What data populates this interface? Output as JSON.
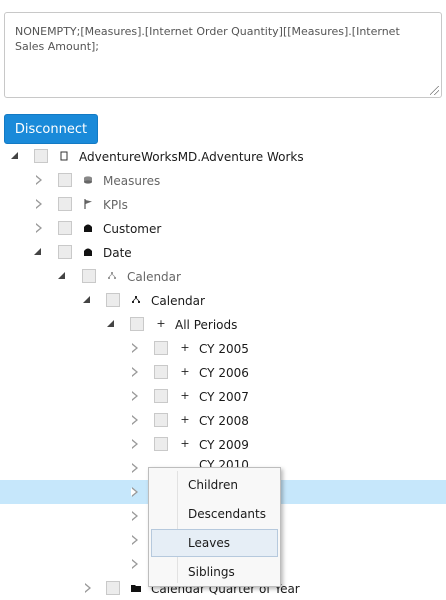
{
  "query": {
    "text": "NONEMPTY;[Measures].[Internet Order Quantity][[Measures].[Internet Sales Amount];"
  },
  "toolbar": {
    "disconnect_label": "Disconnect"
  },
  "tree": {
    "root_label": "AdventureWorksMD.Adventure Works",
    "measures_label": "Measures",
    "kpis_label": "KPIs",
    "customer_label": "Customer",
    "date_label": "Date",
    "calendar_hierarchy_label": "Calendar",
    "calendar_level_label": "Calendar",
    "all_periods_label": "All Periods",
    "cy2005_label": "CY 2005",
    "cy2006_label": "CY 2006",
    "cy2007_label": "CY 2007",
    "cy2008_label": "CY 2008",
    "cy2009_label": "CY 2009",
    "cy2010_label": "CY 2010",
    "calendar_quarter_label": "Calendar Quarter of Year",
    "expand_glyph": "+"
  },
  "context_menu": {
    "items": [
      "Children",
      "Descendants",
      "Leaves",
      "Siblings"
    ]
  },
  "colors": {
    "button_bg": "#1a8ad9",
    "selected_row_bg": "#c6e7fb",
    "menu_hover_bg": "#e6eef6"
  },
  "icons": {
    "root": "cube-icon",
    "measures": "measure-group-icon",
    "kpis": "flag-icon",
    "dimension": "dimension-icon",
    "hierarchy": "hierarchy-icon",
    "member": "plus-member-icon",
    "folder": "folder-icon"
  }
}
